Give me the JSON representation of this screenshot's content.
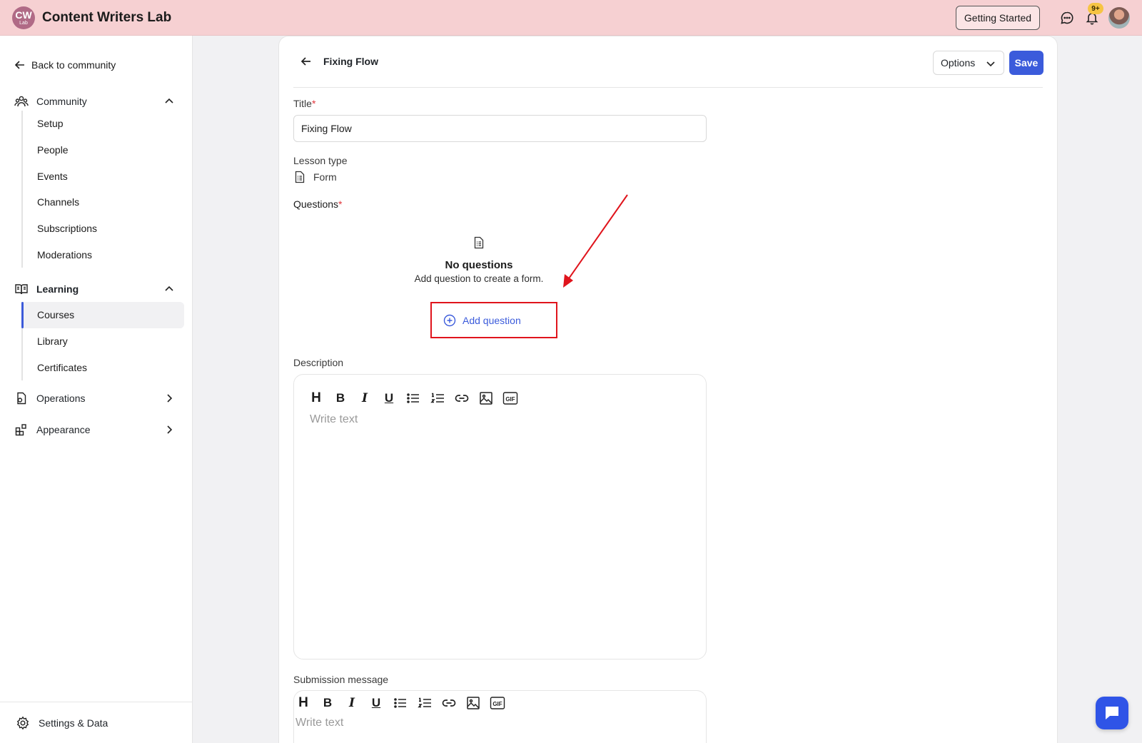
{
  "topbar": {
    "logo_main": "CW",
    "logo_sub": "Lab",
    "brand": "Content Writers Lab",
    "getting_started": "Getting Started",
    "notification_badge": "9+",
    "icons": [
      "chat-icon",
      "bell-icon",
      "avatar"
    ]
  },
  "sidebar": {
    "back_label": "Back to community",
    "community": {
      "label": "Community",
      "items": [
        "Setup",
        "People",
        "Events",
        "Channels",
        "Subscriptions",
        "Moderations"
      ]
    },
    "learning": {
      "label": "Learning",
      "items": [
        "Courses",
        "Library",
        "Certificates"
      ],
      "active": "Courses"
    },
    "operations": {
      "label": "Operations"
    },
    "appearance": {
      "label": "Appearance"
    },
    "settings": "Settings & Data"
  },
  "lesson": {
    "header_title": "Fixing Flow",
    "options_label": "Options",
    "save_label": "Save",
    "title_label": "Title",
    "title_value": "Fixing Flow",
    "lesson_type_label": "Lesson type",
    "lesson_type_value": "Form",
    "questions_label": "Questions",
    "required_mark": "*",
    "empty_title": "No questions",
    "empty_subtitle": "Add question to create a form.",
    "add_question_label": "Add question",
    "description_label": "Description",
    "description_placeholder": "Write text",
    "submission_label": "Submission message",
    "submission_placeholder": "Write text",
    "toolbar": [
      "H",
      "B",
      "I",
      "U",
      "bullet-list",
      "numbered-list",
      "link",
      "image",
      "GIF"
    ]
  },
  "colors": {
    "topbar_bg": "#f6d0d2",
    "accent": "#3b5bdb",
    "annotation_red": "#e0141c"
  }
}
